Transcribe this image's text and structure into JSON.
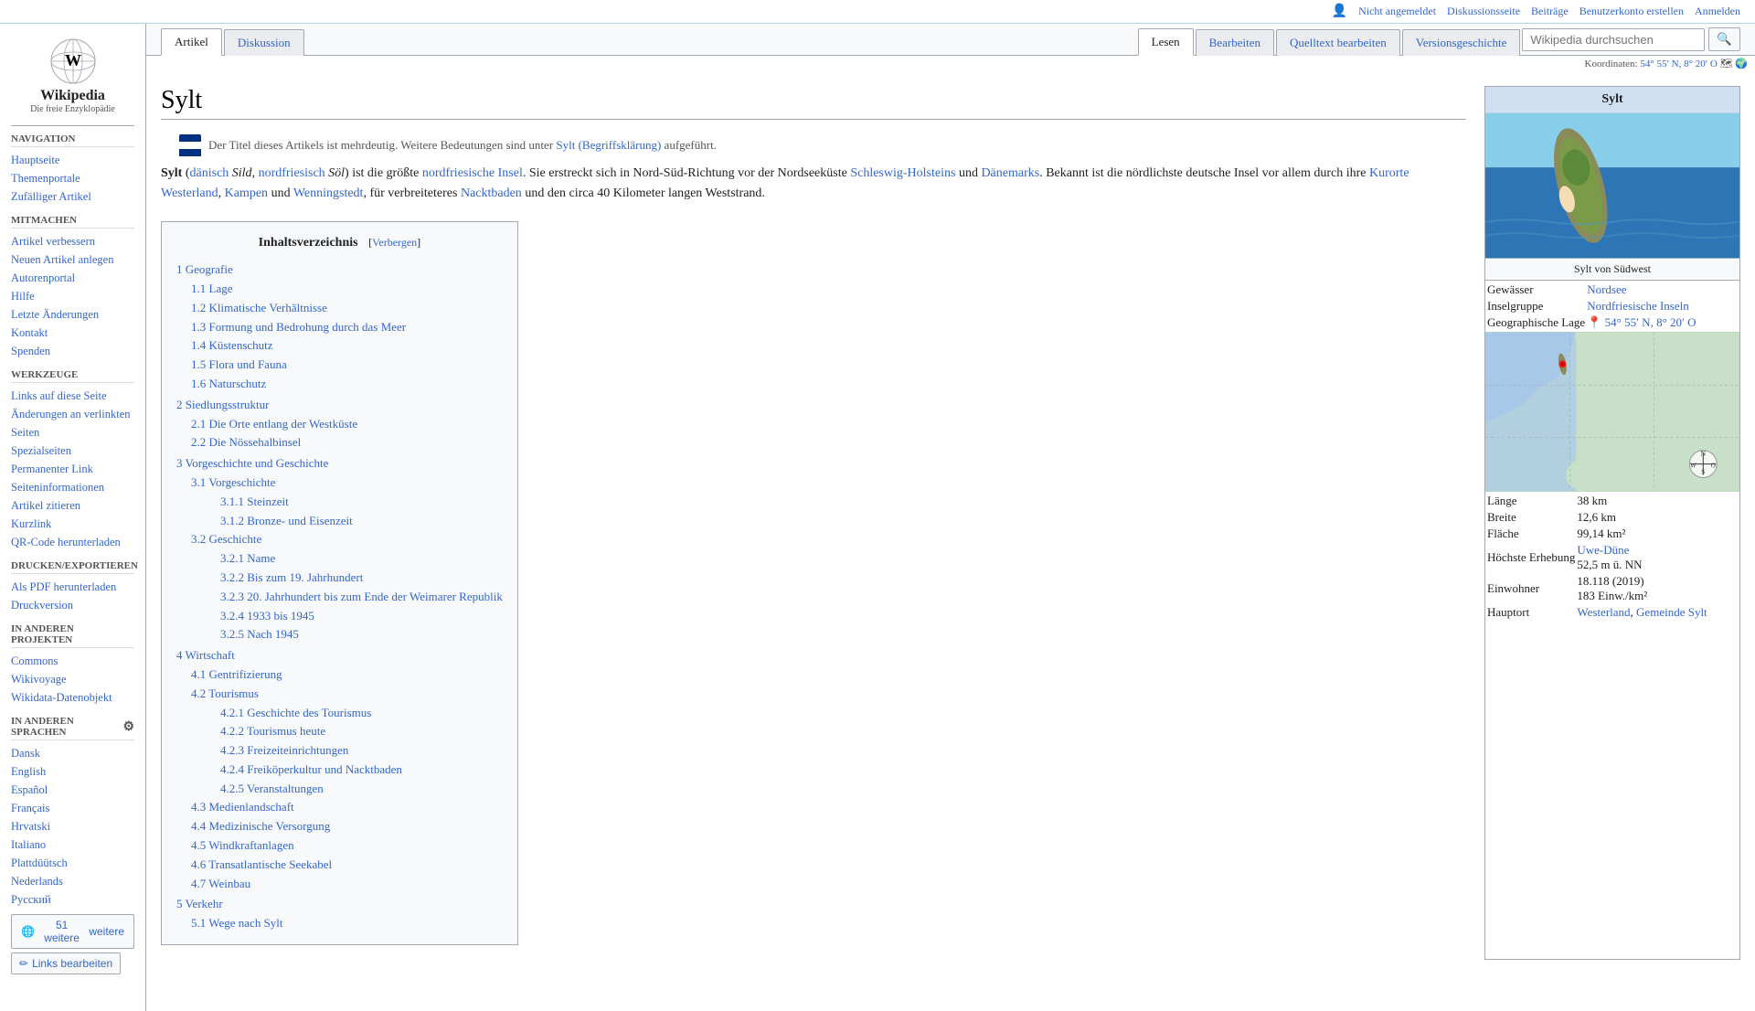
{
  "topbar": {
    "not_logged_in": "Nicht angemeldet",
    "discussion": "Diskussionsseite",
    "contributions": "Beiträge",
    "create_account": "Benutzerkonto erstellen",
    "login": "Anmelden"
  },
  "logo": {
    "site_name": "Wikipedia",
    "site_tagline": "Die freie Enzyklopädie"
  },
  "tabs": {
    "article": "Artikel",
    "discussion": "Diskussion",
    "read": "Lesen",
    "edit": "Bearbeiten",
    "source_edit": "Quelltext bearbeiten",
    "history": "Versionsgeschichte"
  },
  "search": {
    "placeholder": "Wikipedia durchsuchen"
  },
  "sidebar": {
    "nav_title": "Navigation",
    "nav_items": [
      {
        "label": "Hauptseite",
        "href": "#"
      },
      {
        "label": "Themenportale",
        "href": "#"
      },
      {
        "label": "Zufälliger Artikel",
        "href": "#"
      }
    ],
    "participate_title": "Mitmachen",
    "participate_items": [
      {
        "label": "Artikel verbessern",
        "href": "#"
      },
      {
        "label": "Neuen Artikel anlegen",
        "href": "#"
      },
      {
        "label": "Autorenportal",
        "href": "#"
      },
      {
        "label": "Hilfe",
        "href": "#"
      },
      {
        "label": "Letzte Änderungen",
        "href": "#"
      },
      {
        "label": "Kontakt",
        "href": "#"
      },
      {
        "label": "Spenden",
        "href": "#"
      }
    ],
    "tools_title": "Werkzeuge",
    "tools_items": [
      {
        "label": "Links auf diese Seite",
        "href": "#"
      },
      {
        "label": "Änderungen an verlinkten Seiten",
        "href": "#"
      },
      {
        "label": "Spezialseiten",
        "href": "#"
      },
      {
        "label": "Permanenter Link",
        "href": "#"
      },
      {
        "label": "Seiteninformationen",
        "href": "#"
      },
      {
        "label": "Artikel zitieren",
        "href": "#"
      },
      {
        "label": "Kurzlink",
        "href": "#"
      },
      {
        "label": "QR-Code herunterladen",
        "href": "#"
      }
    ],
    "print_title": "Drucken/exportieren",
    "print_items": [
      {
        "label": "Als PDF herunterladen",
        "href": "#"
      },
      {
        "label": "Druckversion",
        "href": "#"
      }
    ],
    "other_projects_title": "In anderen Projekten",
    "other_projects": [
      {
        "label": "Commons",
        "href": "#"
      },
      {
        "label": "Wikivoyage",
        "href": "#"
      },
      {
        "label": "Wikidata-Datenobjekt",
        "href": "#"
      }
    ],
    "languages_title": "In anderen Sprachen",
    "languages": [
      {
        "label": "Dansk",
        "href": "#"
      },
      {
        "label": "English",
        "href": "#"
      },
      {
        "label": "Español",
        "href": "#"
      },
      {
        "label": "Français",
        "href": "#"
      },
      {
        "label": "Hrvatski",
        "href": "#"
      },
      {
        "label": "Italiano",
        "href": "#"
      },
      {
        "label": "Plattdüütsch",
        "href": "#"
      },
      {
        "label": "Nederlands",
        "href": "#"
      },
      {
        "label": "Русский",
        "href": "#"
      }
    ],
    "more_lang_btn": "51 weitere",
    "edit_links_btn": "Links bearbeiten"
  },
  "article": {
    "title": "Sylt",
    "coordinates": "54° 55′ N, 8° 20′ O",
    "hatnote": "Der Titel dieses Artikels ist mehrdeutig. Weitere Bedeutungen sind unter Sylt (Begriffsklärung) aufgeführt.",
    "intro": "Sylt (dänisch Sild, nordfriesisch Söl) ist die größte nordfriesische Insel. Sie erstreckt sich in Nord-Süd-Richtung vor der Nordseeküste Schleswig-Holsteins und Dänemarks. Bekannt ist die nördlichste deutsche Insel vor allem durch ihre Kurorte Westerland, Kampen und Wenningstedt, für verbreiteteres Nacktbaden und den circa 40 Kilometer langen Weststrand.",
    "toc_title": "Inhaltsverzeichnis",
    "toc_toggle": "Verbergen",
    "toc": [
      {
        "num": "1",
        "label": "Geografie",
        "children": [
          {
            "num": "1.1",
            "label": "Lage"
          },
          {
            "num": "1.2",
            "label": "Klimatische Verhältnisse"
          },
          {
            "num": "1.3",
            "label": "Formung und Bedrohung durch das Meer"
          },
          {
            "num": "1.4",
            "label": "Küstenschutz"
          },
          {
            "num": "1.5",
            "label": "Flora und Fauna"
          },
          {
            "num": "1.6",
            "label": "Naturschutz"
          }
        ]
      },
      {
        "num": "2",
        "label": "Siedlungsstruktur",
        "children": [
          {
            "num": "2.1",
            "label": "Die Orte entlang der Westküste"
          },
          {
            "num": "2.2",
            "label": "Die Nössehalbinsel"
          }
        ]
      },
      {
        "num": "3",
        "label": "Vorgeschichte und Geschichte",
        "children": [
          {
            "num": "3.1",
            "label": "Vorgeschichte",
            "children": [
              {
                "num": "3.1.1",
                "label": "Steinzeit"
              },
              {
                "num": "3.1.2",
                "label": "Bronze- und Eisenzeit"
              }
            ]
          },
          {
            "num": "3.2",
            "label": "Geschichte",
            "children": [
              {
                "num": "3.2.1",
                "label": "Name"
              },
              {
                "num": "3.2.2",
                "label": "Bis zum 19. Jahrhundert"
              },
              {
                "num": "3.2.3",
                "label": "20. Jahrhundert bis zum Ende der Weimarer Republik"
              },
              {
                "num": "3.2.4",
                "label": "1933 bis 1945"
              },
              {
                "num": "3.2.5",
                "label": "Nach 1945"
              }
            ]
          }
        ]
      },
      {
        "num": "4",
        "label": "Wirtschaft",
        "children": [
          {
            "num": "4.1",
            "label": "Gentrifizierung"
          },
          {
            "num": "4.2",
            "label": "Tourismus",
            "children": [
              {
                "num": "4.2.1",
                "label": "Geschichte des Tourismus"
              },
              {
                "num": "4.2.2",
                "label": "Tourismus heute"
              },
              {
                "num": "4.2.3",
                "label": "Freizeiteinrichtungen"
              },
              {
                "num": "4.2.4",
                "label": "Freiköperkultur und Nacktbaden"
              },
              {
                "num": "4.2.5",
                "label": "Veranstaltungen"
              }
            ]
          },
          {
            "num": "4.3",
            "label": "Medienlandschaft"
          },
          {
            "num": "4.4",
            "label": "Medizinische Versorgung"
          },
          {
            "num": "4.5",
            "label": "Windkraftanlagen"
          },
          {
            "num": "4.6",
            "label": "Transatlantische Seekabel"
          },
          {
            "num": "4.7",
            "label": "Weinbau"
          }
        ]
      },
      {
        "num": "5",
        "label": "Verkehr",
        "children": [
          {
            "num": "5.1",
            "label": "Wege nach Sylt"
          }
        ]
      }
    ]
  },
  "infobox": {
    "title": "Sylt",
    "image_caption": "Sylt von Südwest",
    "rows": [
      {
        "label": "Gewässer",
        "value": "Nordsee"
      },
      {
        "label": "Inselgruppe",
        "value": "Nordfriesische Inseln"
      },
      {
        "label": "Geographische Lage",
        "value": "54° 55′ N, 8° 20′ O"
      },
      {
        "label": "Länge",
        "value": "38 km"
      },
      {
        "label": "Breite",
        "value": "12,6 km"
      },
      {
        "label": "Fläche",
        "value": "99,14 km²"
      },
      {
        "label": "Höchste Erhebung",
        "value": "Uwe-Düne\n52,5 m ü. NN"
      },
      {
        "label": "Einwohner",
        "value": "18.118 (2019)\n183 Einw./km²"
      },
      {
        "label": "Hauptort",
        "value": "Westerland, Gemeinde Sylt"
      }
    ]
  }
}
